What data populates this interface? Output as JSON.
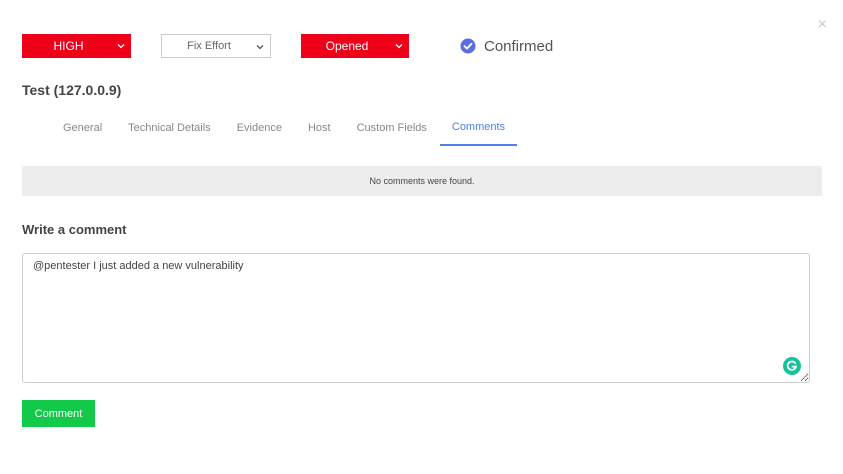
{
  "modal": {
    "close_glyph": "×"
  },
  "controls": {
    "severity": {
      "value": "HIGH",
      "color": "#ee0019"
    },
    "fix_effort": {
      "placeholder": "Fix Effort"
    },
    "status": {
      "value": "Opened",
      "color": "#ee0019"
    },
    "confirmed": {
      "label": "Confirmed",
      "checked": true,
      "color": "#5b6ee1"
    }
  },
  "vulnerability": {
    "title": "Test (127.0.0.9)"
  },
  "tabs": [
    {
      "label": "General",
      "active": false
    },
    {
      "label": "Technical Details",
      "active": false
    },
    {
      "label": "Evidence",
      "active": false
    },
    {
      "label": "Host",
      "active": false
    },
    {
      "label": "Custom Fields",
      "active": false
    },
    {
      "label": "Comments",
      "active": true
    }
  ],
  "comments": {
    "empty_message": "No comments were found.",
    "write_title": "Write a comment",
    "draft_text": "@pentester I just added a new vulnerability",
    "submit_label": "Comment",
    "submit_color": "#12c94a"
  },
  "icons": {
    "close": "close-icon",
    "dropdown": "chevron-down-icon",
    "check": "check-circle-icon",
    "grammarly": "grammarly-icon"
  }
}
